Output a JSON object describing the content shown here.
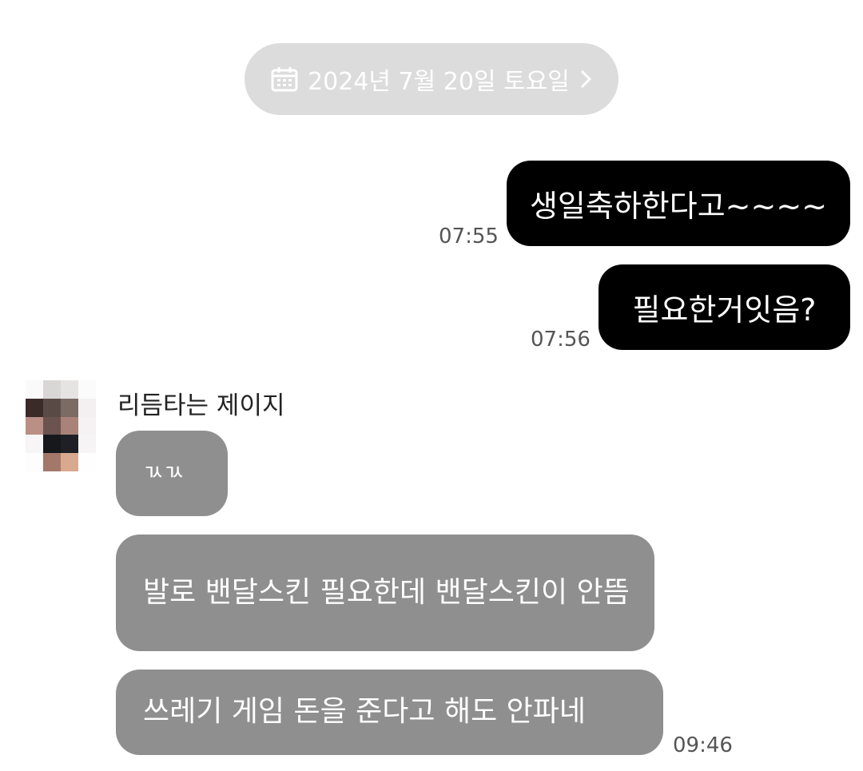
{
  "date_divider": {
    "text": "2024년 7월 20일 토요일",
    "icon": "calendar-icon",
    "chevron": "chevron-right-icon"
  },
  "messages_out": [
    {
      "text": "생일축하한다고~~~~",
      "time": "07:55"
    },
    {
      "text": "필요한거잇음?",
      "time": "07:56"
    }
  ],
  "sender": {
    "name": "리듬타는 제이지",
    "avatar": "avatar-image"
  },
  "messages_in": [
    {
      "text": "ㄳㄳ"
    },
    {
      "text": "발로 밴달스킨 필요한데 밴달스킨이 안뜸"
    },
    {
      "text": "쓰레기 게임 돈을 준다고 해도 안파네",
      "time": "09:46"
    }
  ],
  "colors": {
    "outgoing_bubble": "#000000",
    "incoming_bubble": "#8f8f8f",
    "date_pill": "#dcdcdc",
    "bubble_text": "#ffffff"
  }
}
